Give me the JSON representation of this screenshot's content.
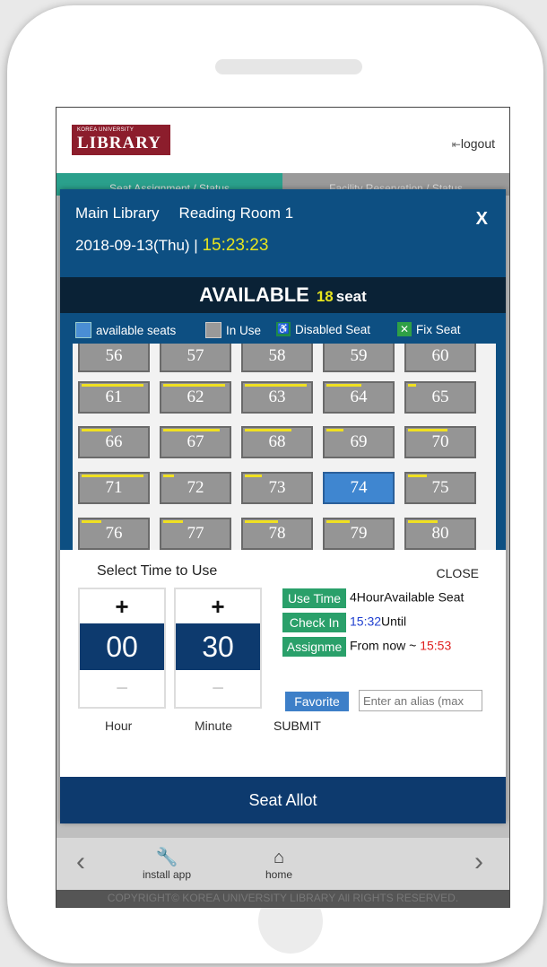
{
  "header": {
    "logo_small": "KOREA UNIVERSITY",
    "logo_big": "LIBRARY",
    "logout_label": "logout",
    "tabs": [
      "Seat Assignment / Status",
      "Facility Reservation / Status"
    ]
  },
  "modal": {
    "library": "Main Library",
    "room": "Reading Room 1",
    "date": "2018-09-13(Thu) | ",
    "time": "15:23:23",
    "close_x": "X",
    "available_label": "AVAILABLE",
    "available_count": "18",
    "available_unit": "seat",
    "legend": {
      "available": "available seats",
      "in_use": "In Use",
      "disabled": "Disabled Seat",
      "fix": "Fix Seat"
    },
    "seats": [
      {
        "n": "56",
        "status": "in_use",
        "use": 0
      },
      {
        "n": "57",
        "status": "in_use",
        "use": 0
      },
      {
        "n": "58",
        "status": "in_use",
        "use": 0
      },
      {
        "n": "59",
        "status": "in_use",
        "use": 0
      },
      {
        "n": "60",
        "status": "in_use",
        "use": 0
      },
      {
        "n": "61",
        "status": "in_use",
        "use": 0.93
      },
      {
        "n": "62",
        "status": "in_use",
        "use": 0.93
      },
      {
        "n": "63",
        "status": "in_use",
        "use": 0.93
      },
      {
        "n": "64",
        "status": "in_use",
        "use": 0.53
      },
      {
        "n": "65",
        "status": "in_use",
        "use": 0.12
      },
      {
        "n": "66",
        "status": "in_use",
        "use": 0.45
      },
      {
        "n": "67",
        "status": "in_use",
        "use": 0.85
      },
      {
        "n": "68",
        "status": "in_use",
        "use": 0.7
      },
      {
        "n": "69",
        "status": "in_use",
        "use": 0.25
      },
      {
        "n": "70",
        "status": "in_use",
        "use": 0.6
      },
      {
        "n": "71",
        "status": "in_use",
        "use": 0.93
      },
      {
        "n": "72",
        "status": "in_use",
        "use": 0.16
      },
      {
        "n": "73",
        "status": "in_use",
        "use": 0.25
      },
      {
        "n": "74",
        "status": "available",
        "use": 0
      },
      {
        "n": "75",
        "status": "in_use",
        "use": 0.28
      },
      {
        "n": "76",
        "status": "in_use",
        "use": 0.3
      },
      {
        "n": "77",
        "status": "in_use",
        "use": 0.3
      },
      {
        "n": "78",
        "status": "in_use",
        "use": 0.5
      },
      {
        "n": "79",
        "status": "in_use",
        "use": 0.35
      },
      {
        "n": "80",
        "status": "in_use",
        "use": 0.45
      }
    ]
  },
  "time_select": {
    "title": "Select Time to Use",
    "close_label": "CLOSE",
    "plus": "+",
    "minus": "−",
    "hour_value": "00",
    "minute_value": "30",
    "hour_label": "Hour",
    "minute_label": "Minute",
    "use_time_tag": "Use Time",
    "use_time_text": "4HourAvailable Seat",
    "check_in_tag": "Check In",
    "check_in_time": "15:32",
    "check_in_suffix": "Until",
    "assign_tag": "Assignme",
    "assign_text": "From now ~ ",
    "assign_time": "15:53",
    "favorite_label": "Favorite",
    "alias_placeholder": "Enter an alias (max",
    "submit_label": "SUBMIT"
  },
  "seat_allot_label": "Seat Allot",
  "footer": {
    "install_label": "install app",
    "home_label": "home",
    "copyright": "COPYRIGHT© KOREA UNIVERSITY LIBRARY All RIGHTS RESERVED."
  },
  "colors": {
    "modal_header": "#0d4f82",
    "accent_yellow": "#e6e41e",
    "tag_green": "#2aa06a",
    "allot_button": "#0d3a6e",
    "available_seat": "#3f86d0",
    "in_use_seat": "#959595"
  }
}
